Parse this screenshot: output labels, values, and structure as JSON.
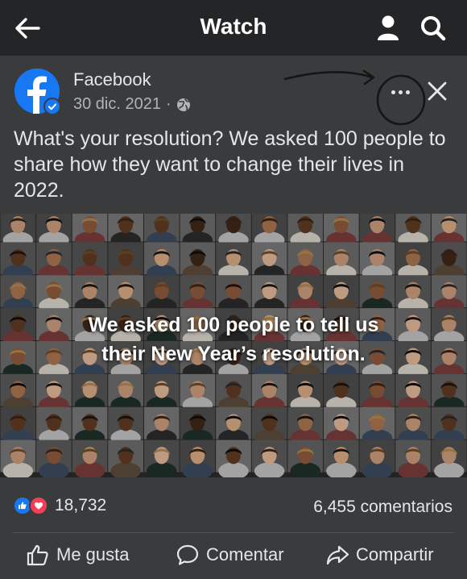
{
  "header": {
    "title": "Watch",
    "icons": [
      "back-arrow-icon",
      "profile-icon",
      "search-icon"
    ]
  },
  "post": {
    "author": "Facebook",
    "date": "30 dic. 2021",
    "separator": "·",
    "caption": "What's your resolution? We asked 100 people to share how they want to change their lives in 2022.",
    "video": {
      "title_line1": "We asked 100 people to tell us",
      "title_line2": "their New Year’s resolution."
    },
    "reactions_count": "18,732",
    "comments_count": "6,455 comentarios",
    "actions": {
      "like": "Me gusta",
      "comment": "Comentar",
      "share": "Compartir"
    }
  },
  "colors": {
    "background": "#242526",
    "card": "#3a3b3c",
    "brand_blue": "#1877f2",
    "love_red": "#f33e58",
    "text": "#e4e6eb",
    "muted": "#b0b3b8"
  }
}
